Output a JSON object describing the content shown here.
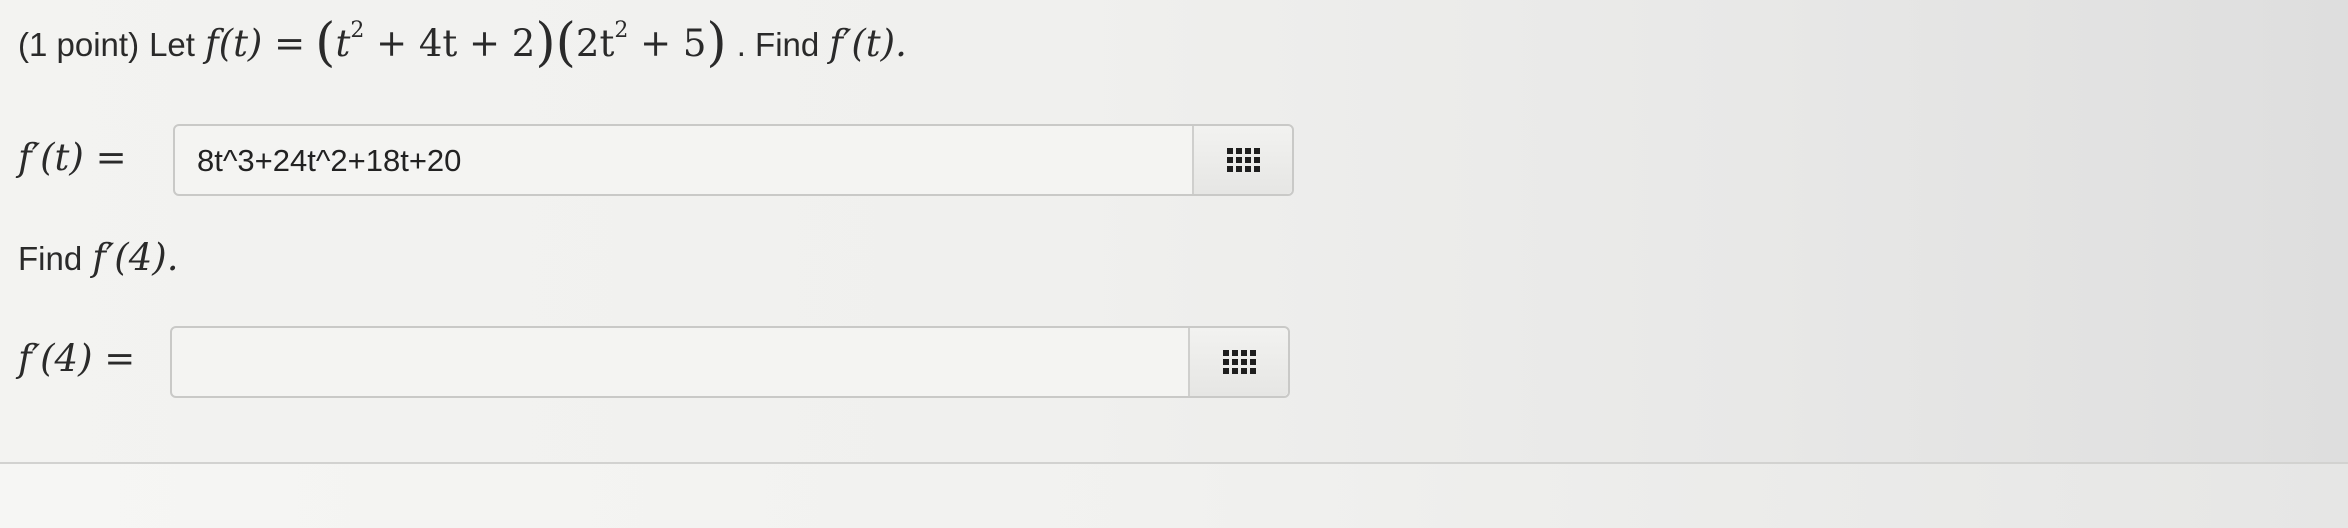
{
  "question": {
    "points": "(1 point)",
    "intro_word": "Let",
    "function_def": {
      "lhs": "f(t) =",
      "factor1": "t",
      "factor1_exp": "2",
      "factor1_rest": "+ 4t + 2",
      "factor2": "2t",
      "factor2_exp": "2",
      "factor2_rest": "+ 5"
    },
    "find_word": ". Find",
    "find_target": "f′(t)."
  },
  "part1": {
    "label": "f′(t) =",
    "answer_value": "8t^3+24t^2+18t+20",
    "palette_icon": "grid-icon"
  },
  "part2": {
    "prompt_word": "Find",
    "prompt_target": "f′(4).",
    "label": "f′(4) =",
    "answer_value": "",
    "palette_icon": "grid-icon"
  }
}
